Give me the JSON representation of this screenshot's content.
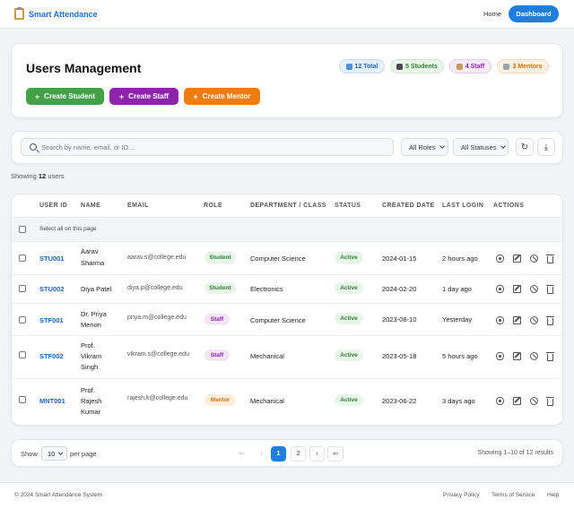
{
  "navbar": {
    "brand": "Smart Attendance",
    "home": "Home",
    "dashboard": "Dashboard"
  },
  "header": {
    "title": "Users Management",
    "pills": {
      "total": "12 Total",
      "students": "5 Students",
      "staff": "4 Staff",
      "mentors": "3 Mentors"
    },
    "buttons": {
      "create_student": "Create Student",
      "create_staff": "Create Staff",
      "create_mentor": "Create Mentor"
    }
  },
  "filters": {
    "search_placeholder": "Search by name, email, or ID...",
    "roles": "All Roles",
    "statuses": "All Statuses"
  },
  "summary": {
    "prefix": "Showing",
    "count": "12",
    "suffix": "users"
  },
  "table": {
    "headers": [
      "USER ID",
      "NAME",
      "EMAIL",
      "ROLE",
      "DEPARTMENT / CLASS",
      "STATUS",
      "CREATED DATE",
      "LAST LOGIN",
      "ACTIONS"
    ],
    "select_all": "Select all on this page",
    "rows": [
      {
        "id": "STU001",
        "name": [
          "Aarav",
          "Sharma"
        ],
        "email": "aarav.s@college.edu",
        "role": "Student",
        "dept": "Computer Science",
        "status": "Active",
        "created": "2024-01-15",
        "last_login": "2 hours ago"
      },
      {
        "id": "STU002",
        "name": [
          "Diya Patel"
        ],
        "email": "diya.p@college.edu",
        "role": "Student",
        "dept": "Electronics",
        "status": "Active",
        "created": "2024-02-20",
        "last_login": "1 day ago"
      },
      {
        "id": "STF001",
        "name": [
          "Dr. Priya",
          "Menon"
        ],
        "email": "priya.m@college.edu",
        "role": "Staff",
        "dept": "Computer Science",
        "status": "Active",
        "created": "2023-08-10",
        "last_login": "Yesterday"
      },
      {
        "id": "STF002",
        "name": [
          "Prof.",
          "Vikram",
          "Singh"
        ],
        "email": "vikram.s@college.edu",
        "role": "Staff",
        "dept": "Mechanical",
        "status": "Active",
        "created": "2023-05-18",
        "last_login": "5 hours ago"
      },
      {
        "id": "MNT001",
        "name": [
          "Prof.",
          "Rajesh",
          "Kumar"
        ],
        "email": "rajesh.k@college.edu",
        "role": "Mentor",
        "dept": "Mechanical",
        "status": "Active",
        "created": "2023-06-22",
        "last_login": "3 days ago"
      }
    ]
  },
  "pagination": {
    "show": "Show",
    "per_page_value": "10",
    "per_page": "per page",
    "first": "«‹",
    "prev": "‹",
    "page1": "1",
    "page2": "2",
    "next": "›",
    "last": "»›",
    "info": "Showing 1–10 of 12 results"
  },
  "footer": {
    "copyright": "© 2024 Smart Attendance System",
    "links": [
      "Privacy Policy",
      "Terms of Service",
      "Help"
    ]
  },
  "colors": {
    "primary": "#1e7fe0",
    "student": "#43a047",
    "staff": "#8e24aa",
    "mentor": "#ef7d0d"
  }
}
